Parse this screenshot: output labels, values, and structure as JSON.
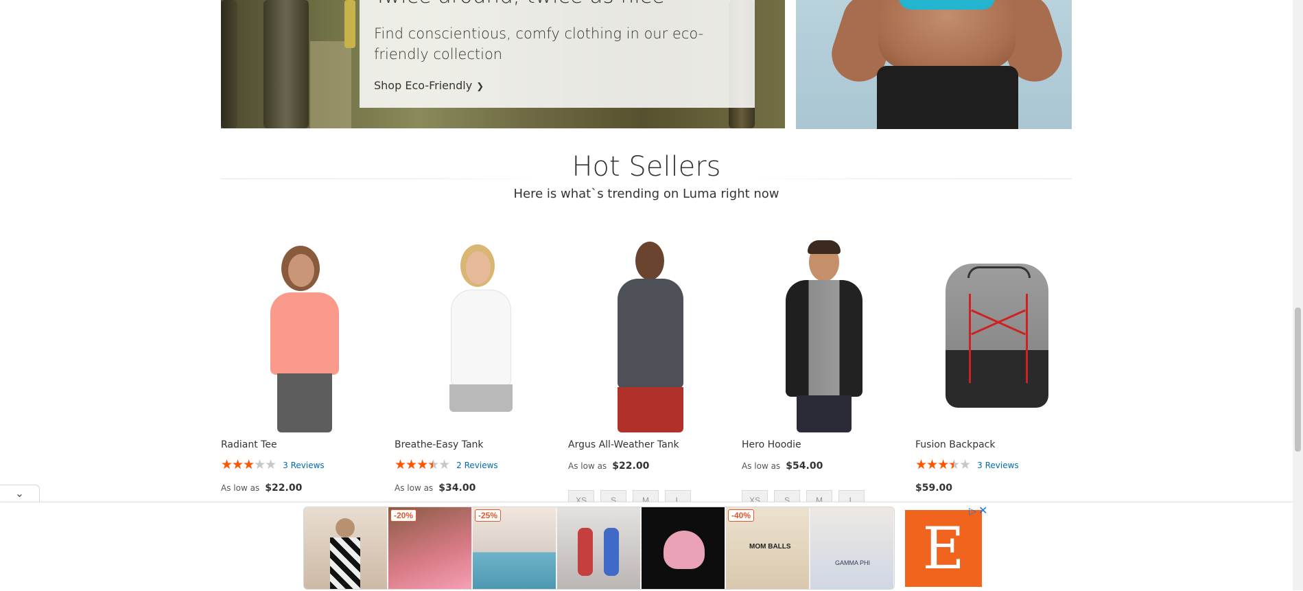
{
  "promo_left": {
    "title": "Twice around, twice as nice",
    "text": "Find conscientious, comfy clothing in our eco-friendly collection",
    "link_label": "Shop Eco-Friendly",
    "link_icon": "chevron-right-icon"
  },
  "hot_sellers": {
    "title": "Hot Sellers",
    "subtitle": "Here is what`s trending on Luma right now",
    "products": [
      {
        "name": "Radiant Tee",
        "rating_percent": 60,
        "reviews": "3 Reviews",
        "price_label": "As low as",
        "price": "$22.00"
      },
      {
        "name": "Breathe-Easy Tank",
        "rating_percent": 70,
        "reviews": "2 Reviews",
        "price_label": "As low as",
        "price": "$34.00"
      },
      {
        "name": "Argus All-Weather Tank",
        "price_label": "As low as",
        "price": "$22.00",
        "sizes": [
          "XS",
          "S",
          "M",
          "L"
        ]
      },
      {
        "name": "Hero Hoodie",
        "price_label": "As low as",
        "price": "$54.00",
        "sizes": [
          "XS",
          "S",
          "M",
          "L"
        ]
      },
      {
        "name": "Fusion Backpack",
        "rating_percent": 70,
        "reviews": "3 Reviews",
        "price": "$59.00"
      }
    ]
  },
  "ad_bar": {
    "collapse_icon": "chevron-down-icon",
    "badges": [
      "-20%",
      "-25%",
      "-40%"
    ],
    "sweatshirt_text": "MOM BALLS",
    "tank_text": "GAMMA PHI",
    "logo_letter": "E",
    "adchoices_icon": "adchoices-icon",
    "close_icon": "close-icon"
  },
  "colors": {
    "star": "#ff5501",
    "link": "#006bb4",
    "etsy_orange": "#f1641e"
  }
}
